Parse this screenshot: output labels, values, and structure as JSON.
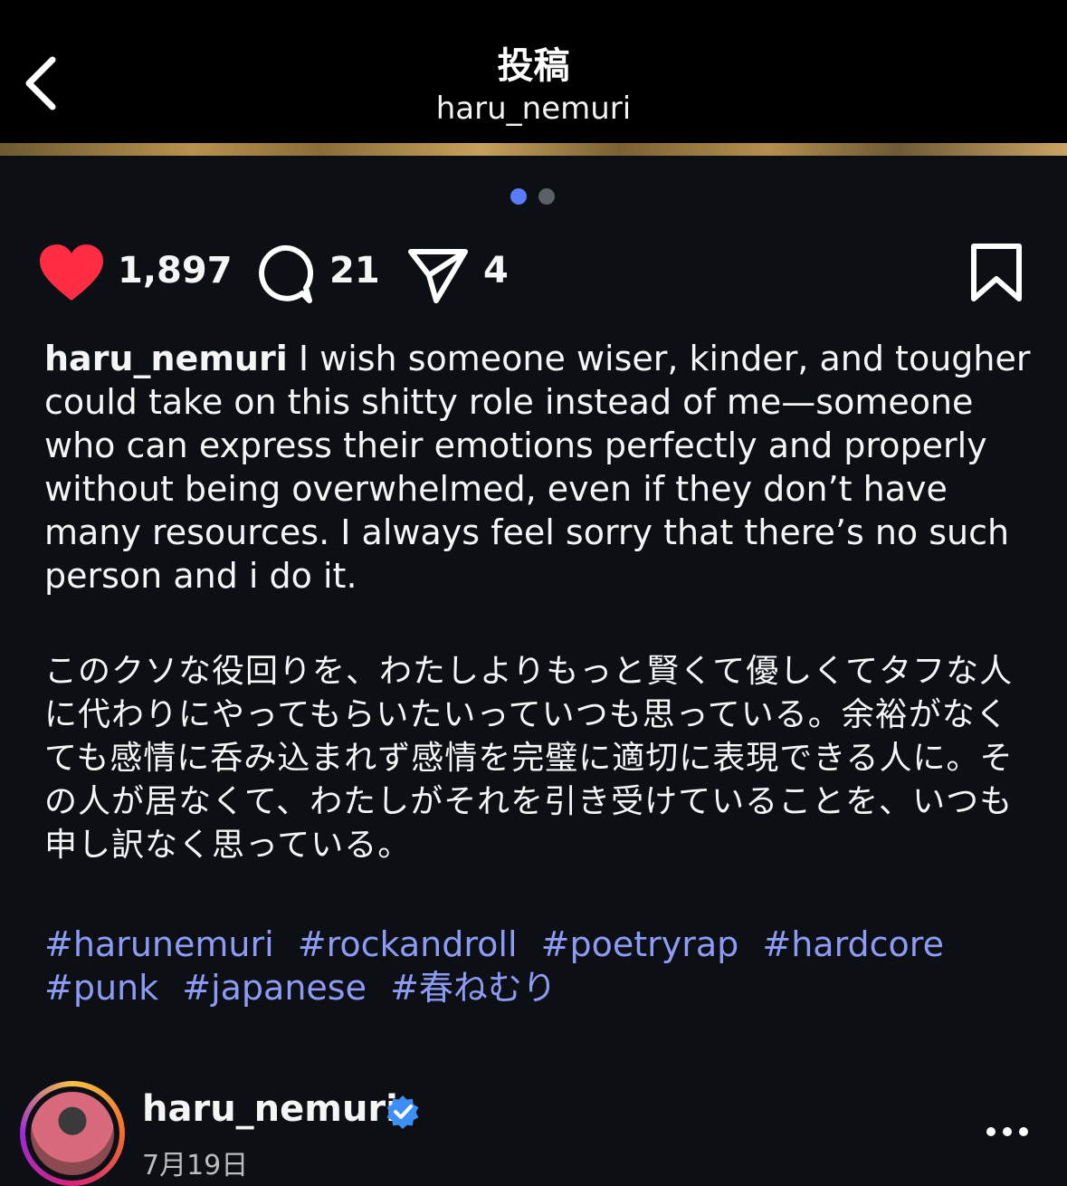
{
  "header": {
    "title": "投稿",
    "subtitle": "haru_nemuri"
  },
  "carousel": {
    "total": 2,
    "current": 1
  },
  "actions": {
    "likes": "1,897",
    "comments": "21",
    "shares": "4",
    "liked": true,
    "colors": {
      "like": "#ff2d43",
      "accent": "#5b7cf7",
      "hashtag": "#8e9bf5"
    }
  },
  "caption": {
    "username": "haru_nemuri",
    "text_en": "I wish someone wiser, kinder, and tougher could take on this shitty role instead of me—someone who can express their emotions perfectly and properly without being overwhelmed, even if they don’t have many resources. I always feel sorry that there’s no such person and i do it.",
    "text_ja": "このクソな役回りを、わたしよりもっと賢くて優しくてタフな人に代わりにやってもらいたいっていつも思っている。余裕がなくても感情に呑み込まれず感情を完璧に適切に表現できる人に。その人が居なくて、わたしがそれを引き受けていることを、いつも申し訳なく思っている。",
    "hashtags": [
      "#harunemuri",
      "#rockandroll",
      "#poetryrap",
      "#hardcore",
      "#punk",
      "#japanese",
      "#春ねむり"
    ]
  },
  "author": {
    "name": "haru_nemuri",
    "verified": true,
    "date": "7月19日"
  },
  "icons": [
    "back-chevron-icon",
    "heart-icon",
    "comment-icon",
    "share-icon",
    "bookmark-icon",
    "verified-icon",
    "more-icon"
  ]
}
